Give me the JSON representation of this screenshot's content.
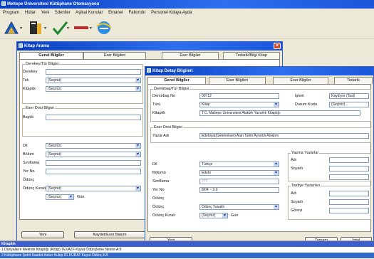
{
  "main": {
    "title": "Meltepe Üniversitesi Kütüphane Otomasyonu",
    "menu": [
      "Program",
      "Hizlar",
      "Yeni",
      "Sdeniler",
      "Aşikal Konular",
      "Emanet",
      "Fatkırıdır",
      "Personel Kdaya Ayda"
    ]
  },
  "search_dialog": {
    "title": "Kitap Arama",
    "tabs": [
      "Genel Bilgiler",
      "Eser Bilgileri",
      "Eser Bilgiler",
      "Tedarik/Bilgi Kitap"
    ],
    "group_title": "Derekey/Tür Bilgisi",
    "labels": {
      "demirbas": "Derekey",
      "tur": "Tek",
      "kitaplik": "Kitaplık",
      "eser": "Eser Dosi Bilgisi",
      "baslik": "Başlık",
      "dil": "Dil",
      "bolum": "Bölüm",
      "sinif": "Sınıflama",
      "yer": "Yer No",
      "oduncg": "Ödünç",
      "durum": "Ödünç Kuralı"
    },
    "values": {
      "tur": "(Seçiniz)",
      "kitaplik": "(Seçiniz)",
      "dil": "(Seçiniz)",
      "bolum": "(Seçiniz)",
      "durum": "(Seçiniz)",
      "odunc_kurali": "(Seçiniz)",
      "gun": "Gün"
    },
    "buttons": {
      "yeni": "Yeni",
      "kaydet": "Kaydet/Eser Basım"
    }
  },
  "detail_dialog": {
    "title": "Kitap Detay Bilgileri",
    "tabs": [
      "Genel Bilgiler",
      "Eser Bilgileri",
      "Eser Bilgiler",
      "Tedarik"
    ],
    "group_title": "Demirbaş/Tür Bilgisi",
    "labels": {
      "demirbas": "Demirbaş No",
      "tur": "Türü",
      "kitaplik": "Kitaplık",
      "eser_group": "Eser Dosi Bilgisi",
      "yazar": "Yazar Adı",
      "dil": "Dil",
      "bolum": "Bölümü",
      "sinif": "Sınıflama",
      "yer": "Yer No",
      "odunc_group": "Ödünç",
      "odunc": "Ödünç",
      "kurali": "Ödünç Kuralı",
      "islem": "İşlem",
      "durum": "Durum Kodu",
      "yazar_group": "Yazma Yazarlar",
      "adi": "Adı",
      "soyadi": "Soyadı",
      "ceviri_group": "Tasfiye Yazarları",
      "adi2": "Adı",
      "soyadi2": "Soyadı",
      "gorevi": "Görevi",
      "gun": "Gün"
    },
    "values": {
      "demirbas": "00712",
      "tur": "Kitap",
      "kitaplik": "T.C. Maltepe Üniversitesi Atatürk Yazarlık Kitaplığı",
      "yazar": "Edebiyat(Geleneksel) Alan Tarihi Ayrıntılı Anlatım",
      "islem": "Kaydıyor (Tasi)",
      "durum": "(Seçiniz)",
      "dil": "Türkçe",
      "bolum": "Edebi",
      "sinif": "???",
      "yer": "8/04 ~ 3.0",
      "odunc": "Ödünç Yasaklı",
      "kurali": "(Seçiniz)"
    },
    "buttons": {
      "yeni": "Yeni",
      "tamam": "Tamam",
      "iptal": "İptal"
    }
  },
  "status": {
    "head": "Kitaplık",
    "rows": [
      "1  Dünyaların Mektebi Kitaplığı (Kitap)    TEVAZF Kuyut    Ödünçleme Nesne    A:II",
      "2  Kütüphane Şehit Saadet Asker Kulüp      81 KURAT Kuyut  Ödünç    KA"
    ]
  }
}
